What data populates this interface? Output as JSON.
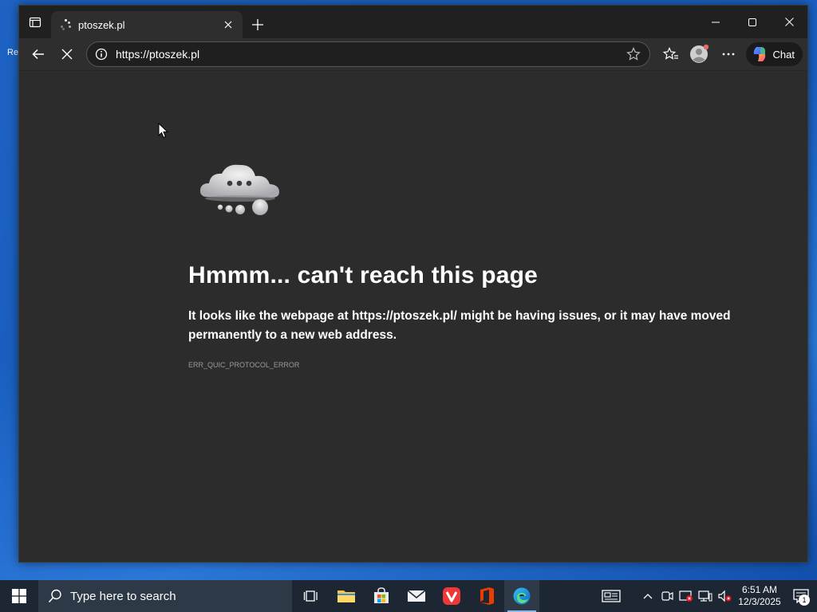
{
  "desktop": {
    "label": "Re"
  },
  "browser": {
    "tab": {
      "title": "ptoszek.pl"
    },
    "address": {
      "url": "https://ptoszek.pl"
    },
    "chat_label": "Chat"
  },
  "error": {
    "title": "Hmmm... can't reach this page",
    "desc_prefix": "It looks like the webpage at ",
    "desc_url": "https://ptoszek.pl/",
    "desc_suffix": " might be having issues, or it may have moved permanently to a new web address.",
    "code": "ERR_QUIC_PROTOCOL_ERROR"
  },
  "taskbar": {
    "search_placeholder": "Type here to search",
    "time": "6:51 AM",
    "date": "12/3/2025",
    "notification_count": "1"
  },
  "icons": {
    "tab_actions": "tab-actions-icon",
    "loading": "loading-spinner-icon",
    "close": "close-icon",
    "new_tab": "plus-icon",
    "minimize": "minimize-icon",
    "maximize": "maximize-icon",
    "back": "back-arrow-icon",
    "stop": "stop-icon",
    "info": "info-icon",
    "favorite": "star-icon",
    "favorites": "favorites-icon",
    "profile": "profile-icon",
    "more": "more-icon",
    "copilot": "copilot-icon"
  }
}
